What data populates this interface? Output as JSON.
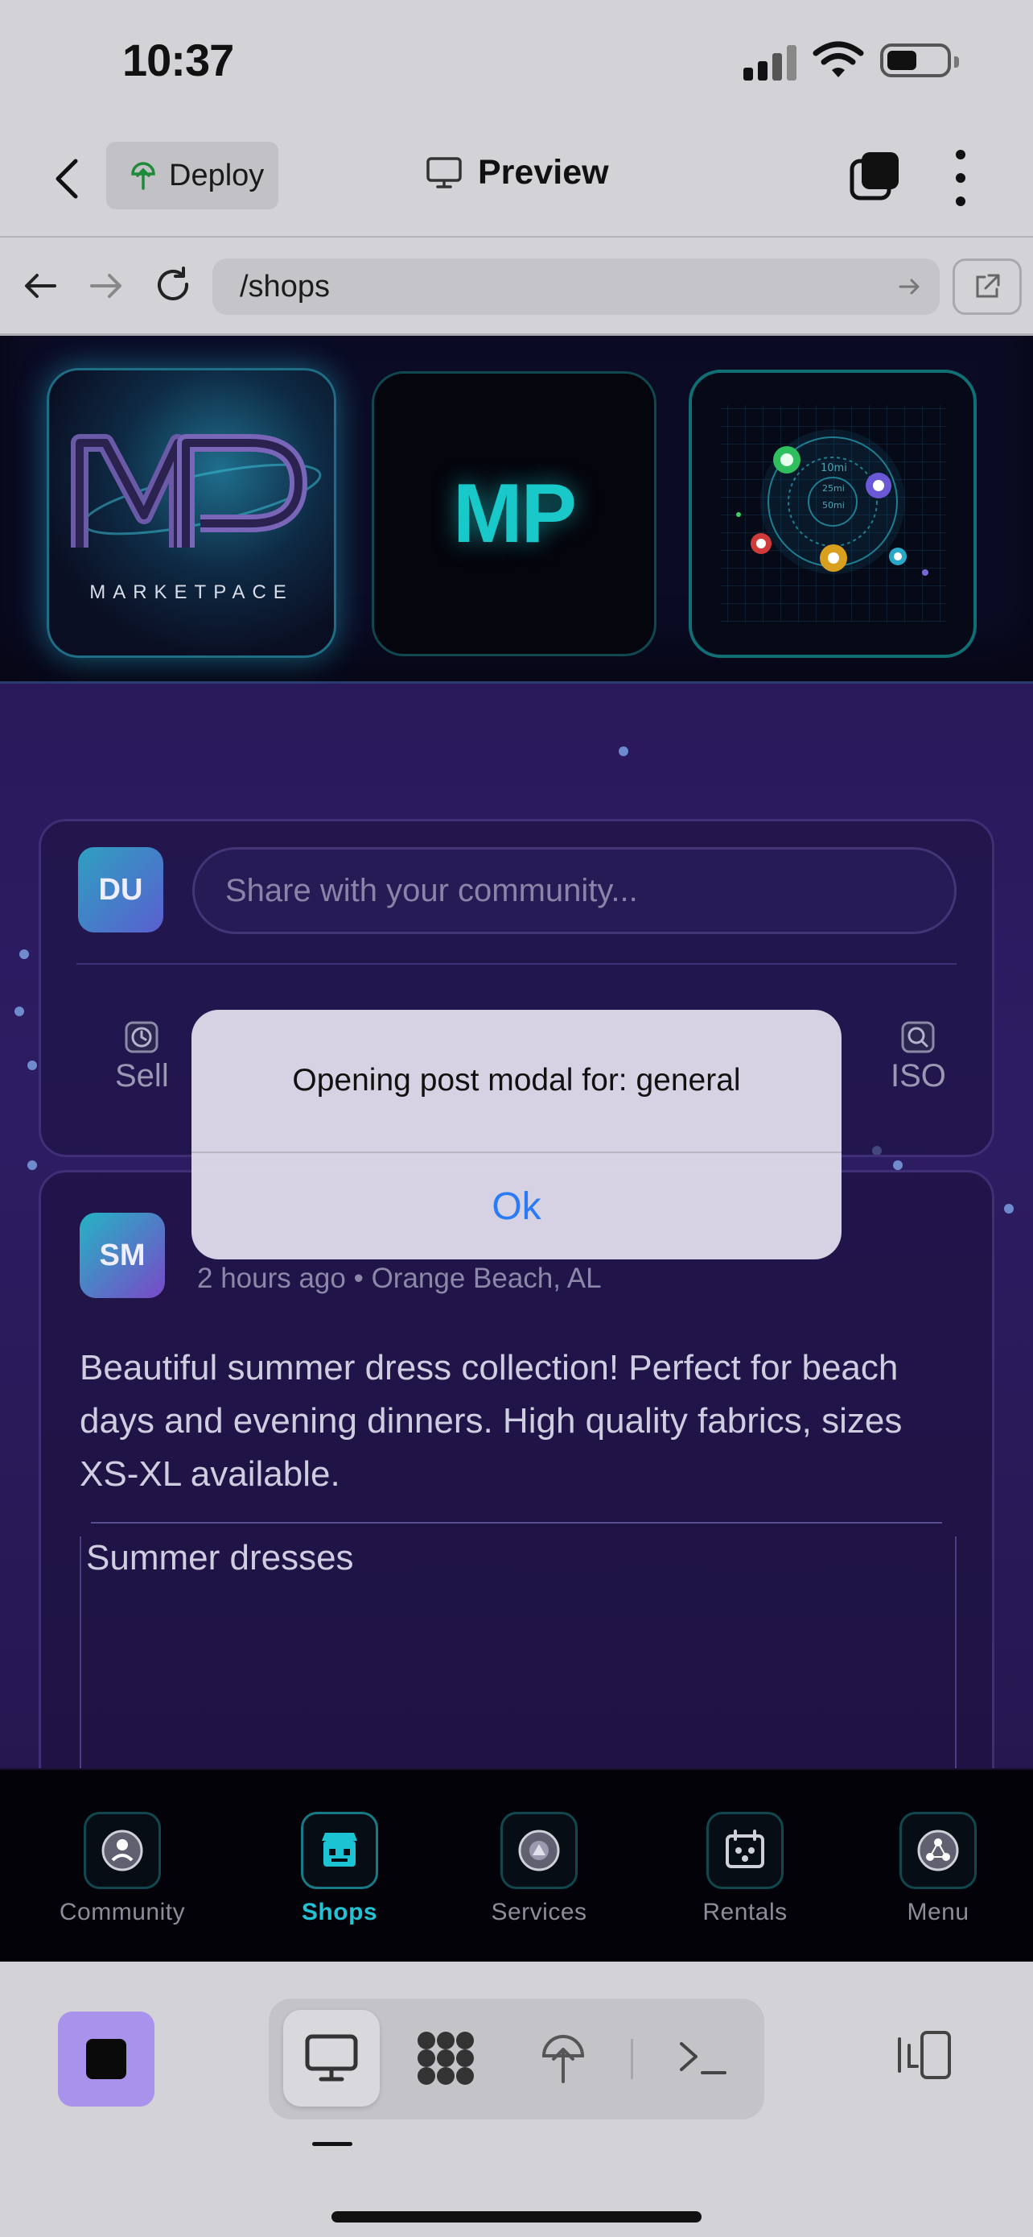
{
  "status_bar": {
    "time": "10:37"
  },
  "header": {
    "deploy_label": "Deploy",
    "title": "Preview"
  },
  "browser": {
    "url": "/shops"
  },
  "hero": {
    "logo_word": "MARKETPACE",
    "mp_text": "MP",
    "map_labels": [
      "10mi",
      "25mi",
      "50mi"
    ]
  },
  "composer": {
    "avatar_initials": "DU",
    "placeholder": "Share with your community...",
    "actions": [
      {
        "label": "Sell",
        "icon": "clock-icon"
      },
      {
        "label": "ISO",
        "icon": "search-icon"
      }
    ]
  },
  "post": {
    "avatar_initials": "SM",
    "meta": "2 hours ago • Orange Beach, AL",
    "body": "Beautiful summer dress collection! Perfect for beach days and evening dinners. High quality fabrics, sizes XS-XL available.",
    "gallery_caption": "Summer dresses"
  },
  "alert": {
    "message": "Opening post modal for: general",
    "ok_label": "Ok"
  },
  "app_nav": {
    "items": [
      {
        "label": "Community",
        "icon": "community-icon"
      },
      {
        "label": "Shops",
        "icon": "shop-icon",
        "active": true
      },
      {
        "label": "Services",
        "icon": "services-icon"
      },
      {
        "label": "Rentals",
        "icon": "rentals-icon"
      },
      {
        "label": "Menu",
        "icon": "menu-icon"
      }
    ]
  },
  "colors": {
    "accent_cyan": "#21c3d4",
    "alert_button": "#2a7bf5",
    "stop_button": "#a992ec",
    "page_bg": "#2a1a5c"
  }
}
